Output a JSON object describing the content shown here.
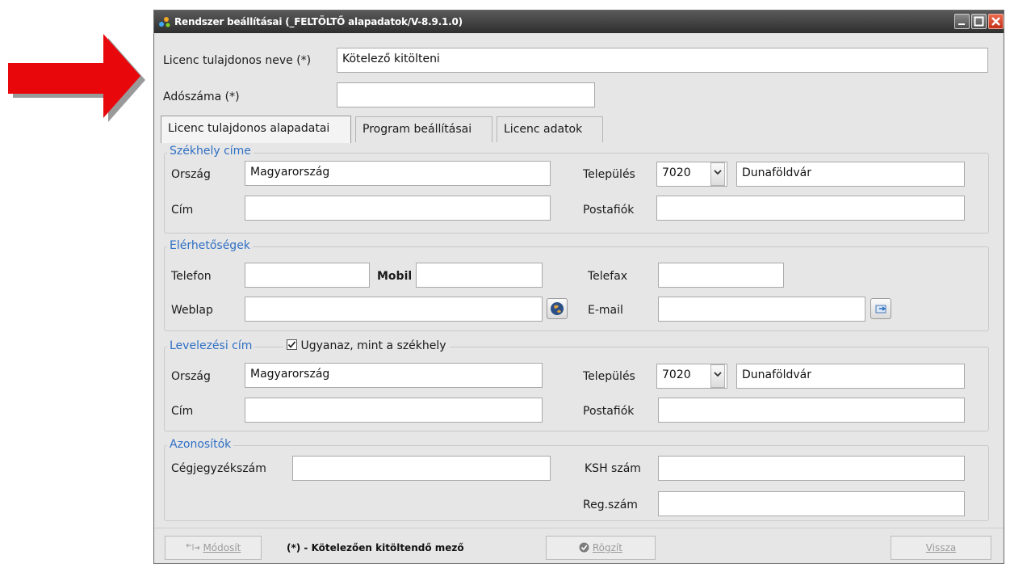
{
  "window": {
    "title": "Rendszer beállításai (_FELTÖLTŐ alapadatok/V-8.9.1.0)",
    "accent_color": "#2f6fc4"
  },
  "header": {
    "owner_name_label": "Licenc tulajdonos neve (*)",
    "owner_name_value": "Kötelező kitölteni",
    "tax_number_label": "Adószáma (*)",
    "tax_number_value": ""
  },
  "tabs": [
    {
      "label": "Licenc tulajdonos alapadatai",
      "active": true
    },
    {
      "label": "Program beállításai",
      "active": false
    },
    {
      "label": "Licenc adatok",
      "active": false
    }
  ],
  "seat": {
    "legend": "Székhely címe",
    "country_label": "Ország",
    "country_value": "Magyarország",
    "city_label": "Település",
    "zip_value": "7020",
    "city_value": "Dunaföldvár",
    "address_label": "Cím",
    "address_value": "",
    "pobox_label": "Postafiók",
    "pobox_value": ""
  },
  "contacts": {
    "legend": "Elérhetőségek",
    "phone_label": "Telefon",
    "phone_value": "",
    "mobile_label": "Mobil",
    "mobile_value": "",
    "fax_label": "Telefax",
    "fax_value": "",
    "web_label": "Weblap",
    "web_value": "",
    "email_label": "E-mail",
    "email_value": ""
  },
  "mailing": {
    "legend": "Levelezési cím",
    "same_checkbox_label": "Ugyanaz, mint a székhely",
    "same_checked": true,
    "country_label": "Ország",
    "country_value": "Magyarország",
    "city_label": "Település",
    "zip_value": "7020",
    "city_value": "Dunaföldvár",
    "address_label": "Cím",
    "address_value": "",
    "pobox_label": "Postafiók",
    "pobox_value": ""
  },
  "ids": {
    "legend": "Azonosítók",
    "company_reg_label": "Cégjegyzékszám",
    "company_reg_value": "",
    "ksh_label": "KSH szám",
    "ksh_value": "",
    "reg_label": "Reg.szám",
    "reg_value": ""
  },
  "footer": {
    "modify_label": "Módosít",
    "note": "(*) - Kötelezően kitöltendő mező",
    "save_label": "Rögzít",
    "back_label": "Vissza"
  },
  "arrow_color": "#e8080c"
}
